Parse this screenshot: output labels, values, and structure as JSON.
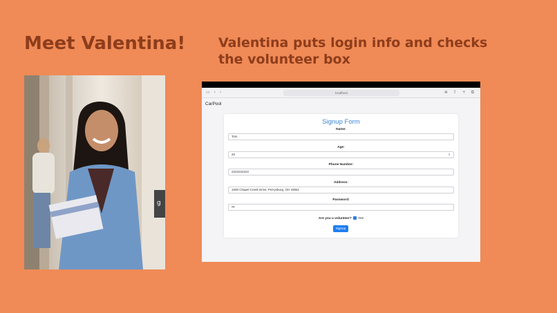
{
  "slide": {
    "title": "Meet Valentina!",
    "caption": "Valentina puts login info and checks the volunteer box"
  },
  "colors": {
    "background": "#F08A56",
    "heading": "#8E3D1B",
    "form_title": "#3a86d4",
    "button": "#1e7ef0"
  },
  "browser": {
    "address": "localhost",
    "app_name": "CarPool"
  },
  "form": {
    "title": "Signup Form",
    "name_label": "Name:",
    "name_value": "Tom",
    "age_label": "Age:",
    "age_value": "20",
    "phone_label": "Phone Number:",
    "phone_value": "2222222222",
    "address_label": "Address:",
    "address_value": "1000 Chapel Creek Drive, Perrysburg, OH 43551",
    "password_label": "Password:",
    "password_value": "•••",
    "volunteer_label": "Are you a volunteer?",
    "volunteer_yes": "Yes",
    "volunteer_checked": true,
    "signup_label": "Signup"
  }
}
